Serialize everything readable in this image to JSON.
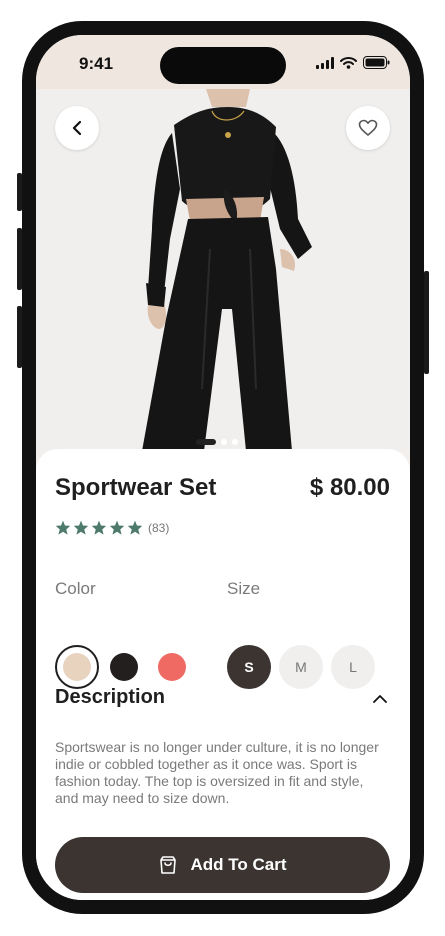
{
  "status_bar": {
    "time": "9:41"
  },
  "product": {
    "name": "Sportwear Set",
    "price": "$ 80.00",
    "rating_stars": 5,
    "rating_count": "(83)"
  },
  "gallery": {
    "image_count": 3,
    "active_index": 0
  },
  "color": {
    "label": "Color",
    "options": [
      "#e8d3bf",
      "#231f1e",
      "#ee6a62"
    ],
    "selected_index": 0
  },
  "size": {
    "label": "Size",
    "options": [
      "S",
      "M",
      "L"
    ],
    "selected": "S"
  },
  "description": {
    "heading": "Description",
    "text": "Sportswear is no longer under culture, it is no longer indie or cobbled together as it once was. Sport is fashion today. The top is oversized in fit and style, and may need to size down."
  },
  "cart_button": {
    "label": "Add To Cart"
  },
  "colors": {
    "accent_dark": "#3b3431",
    "star": "#4e7a6a",
    "header_bg": "#efe6df"
  }
}
